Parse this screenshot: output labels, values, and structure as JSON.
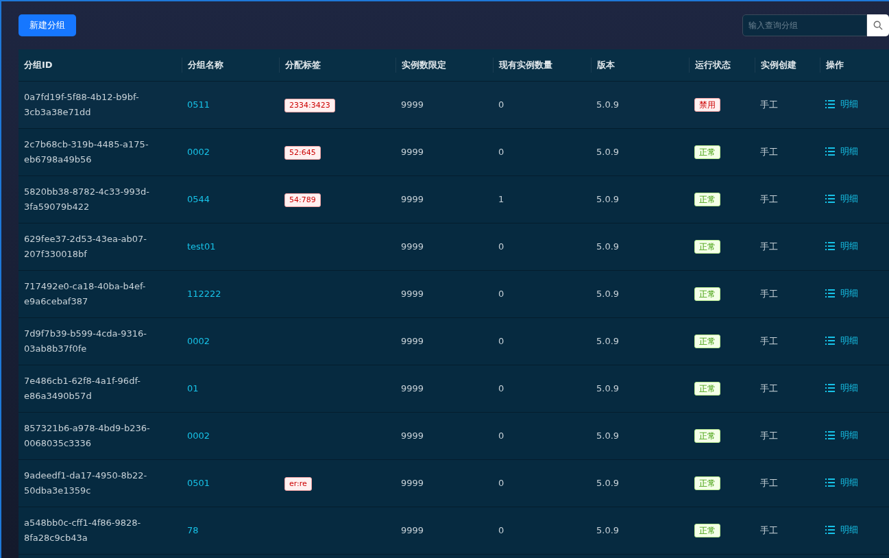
{
  "toolbar": {
    "new_button": "新建分组",
    "search": {
      "placeholder": "输入查询分组"
    }
  },
  "table": {
    "columns": [
      "分组ID",
      "分组名称",
      "分配标签",
      "实例数限定",
      "现有实例数量",
      "版本",
      "运行状态",
      "实例创建",
      "操作"
    ],
    "rows": [
      {
        "id": "0a7fd19f-5f88-4b12-b9bf-3cb3a38e71dd",
        "name": "0511",
        "tag": "2334:3423",
        "limit": "9999",
        "count": "0",
        "version": "5.0.9",
        "status": {
          "kind": "danger",
          "label": "禁用"
        },
        "creation": "手工",
        "action": "明细"
      },
      {
        "id": "2c7b68cb-319b-4485-a175-eb6798a49b56",
        "name": "0002",
        "tag": "52:645",
        "limit": "9999",
        "count": "0",
        "version": "5.0.9",
        "status": {
          "kind": "success",
          "label": "正常"
        },
        "creation": "手工",
        "action": "明细"
      },
      {
        "id": "5820bb38-8782-4c33-993d-3fa59079b422",
        "name": "0544",
        "tag": "54:789",
        "limit": "9999",
        "count": "1",
        "version": "5.0.9",
        "status": {
          "kind": "success",
          "label": "正常"
        },
        "creation": "手工",
        "action": "明细"
      },
      {
        "id": "629fee37-2d53-43ea-ab07-207f330018bf",
        "name": "test01",
        "limit": "9999",
        "count": "0",
        "version": "5.0.9",
        "status": {
          "kind": "success",
          "label": "正常"
        },
        "creation": "手工",
        "action": "明细"
      },
      {
        "id": "717492e0-ca18-40ba-b4ef-e9a6cebaf387",
        "name": "112222",
        "limit": "9999",
        "count": "0",
        "version": "5.0.9",
        "status": {
          "kind": "success",
          "label": "正常"
        },
        "creation": "手工",
        "action": "明细"
      },
      {
        "id": "7d9f7b39-b599-4cda-9316-03ab8b37f0fe",
        "name": "0002",
        "limit": "9999",
        "count": "0",
        "version": "5.0.9",
        "status": {
          "kind": "success",
          "label": "正常"
        },
        "creation": "手工",
        "action": "明细"
      },
      {
        "id": "7e486cb1-62f8-4a1f-96df-e86a3490b57d",
        "name": "01",
        "limit": "9999",
        "count": "0",
        "version": "5.0.9",
        "status": {
          "kind": "success",
          "label": "正常"
        },
        "creation": "手工",
        "action": "明细"
      },
      {
        "id": "857321b6-a978-4bd9-b236-0068035c3336",
        "name": "0002",
        "limit": "9999",
        "count": "0",
        "version": "5.0.9",
        "status": {
          "kind": "success",
          "label": "正常"
        },
        "creation": "手工",
        "action": "明细"
      },
      {
        "id": "9adeedf1-da17-4950-8b22-50dba3e1359c",
        "name": "0501",
        "tag": "er:re",
        "limit": "9999",
        "count": "0",
        "version": "5.0.9",
        "status": {
          "kind": "success",
          "label": "正常"
        },
        "creation": "手工",
        "action": "明细"
      },
      {
        "id": "a548bb0c-cff1-4f86-9828-8fa28c9cb43a",
        "name": "78",
        "limit": "9999",
        "count": "0",
        "version": "5.0.9",
        "status": {
          "kind": "success",
          "label": "正常"
        },
        "creation": "手工",
        "action": "明细"
      }
    ]
  }
}
